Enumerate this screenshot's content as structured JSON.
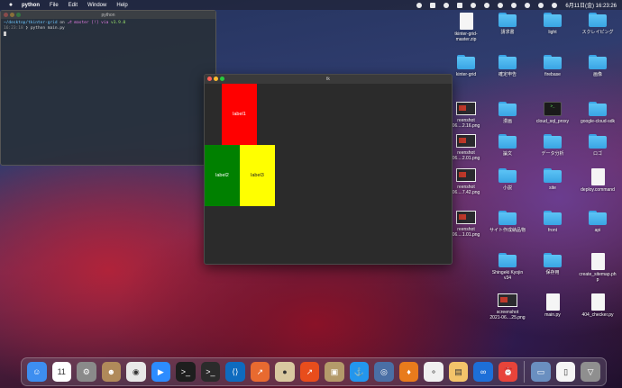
{
  "menubar": {
    "app_name": "python",
    "items": [
      "File",
      "Edit",
      "Window",
      "Help"
    ],
    "clock": "6月11日(金)  16:23:26"
  },
  "terminal": {
    "title": "python",
    "line1_path": "~/desktop/tkinter-grid",
    "line1_on": " on ",
    "line1_branch": "⎇ master [!] via ",
    "line1_ver": "v3.9.0",
    "line2_time": "16:23:18",
    "line2_cmd": " ❯ python main.py"
  },
  "tk_window": {
    "title": "tk",
    "labels": [
      {
        "text": "label1",
        "color": "#ff0000"
      },
      {
        "text": "label2",
        "color": "#008000"
      },
      {
        "text": "label3",
        "color": "#ffff00"
      }
    ]
  },
  "desktop": {
    "items": [
      {
        "label": "tkinter-grid-\nmaster.zip",
        "kind": "zip"
      },
      {
        "label": "請求書",
        "kind": "folder"
      },
      {
        "label": "light",
        "kind": "folder"
      },
      {
        "label": "スクレイピング",
        "kind": "folder"
      },
      {
        "label": "kinter-grid",
        "kind": "folder"
      },
      {
        "label": "確定申告",
        "kind": "folder"
      },
      {
        "label": "firebase",
        "kind": "folder"
      },
      {
        "label": "画像",
        "kind": "folder"
      },
      {
        "label": "reenshot\n06....2.16.png",
        "kind": "thumb"
      },
      {
        "label": "漫画",
        "kind": "folder"
      },
      {
        "label": "cloud_sql_proxy",
        "kind": "exec"
      },
      {
        "label": "google-cloud-sdk",
        "kind": "folder"
      },
      {
        "label": "reenshot\n06....2.01.png",
        "kind": "thumb"
      },
      {
        "label": "論文",
        "kind": "folder"
      },
      {
        "label": "データ分析",
        "kind": "folder"
      },
      {
        "label": "ロゴ",
        "kind": "folder"
      },
      {
        "label": "reenshot\n06....7.42.png",
        "kind": "thumb"
      },
      {
        "label": "小説",
        "kind": "folder"
      },
      {
        "label": "site",
        "kind": "folder"
      },
      {
        "label": "deploy.command",
        "kind": "doc"
      },
      {
        "label": "reenshot\n06....1.01.png",
        "kind": "thumb"
      },
      {
        "label": "サイト作成納品物",
        "kind": "folder"
      },
      {
        "label": "front",
        "kind": "folder"
      },
      {
        "label": "api",
        "kind": "folder"
      },
      {
        "label": "Shingeki Kyojin\nv34",
        "kind": "folder"
      },
      {
        "label": "保存用",
        "kind": "folder"
      },
      {
        "label": "create_sitemap.ph\np",
        "kind": "doc"
      },
      {
        "label": "screenshot\n2021-06....25.png",
        "kind": "thumb"
      },
      {
        "label": "main.py",
        "kind": "doc"
      },
      {
        "label": "404_checker.py",
        "kind": "doc"
      }
    ]
  },
  "dock": {
    "apps": [
      {
        "name": "finder-icon",
        "color": "#3d8ef0",
        "glyph": "☺"
      },
      {
        "name": "calendar-icon",
        "color": "#ffffff",
        "glyph": "11"
      },
      {
        "name": "system-preferences-icon",
        "color": "#8a8a8a",
        "glyph": "⚙"
      },
      {
        "name": "contacts-icon",
        "color": "#b08a5a",
        "glyph": "☻"
      },
      {
        "name": "chrome-icon",
        "color": "#e8e8e8",
        "glyph": "◉"
      },
      {
        "name": "zoom-icon",
        "color": "#2d8cff",
        "glyph": "▶"
      },
      {
        "name": "terminal-icon",
        "color": "#1e1e1e",
        "glyph": ">_"
      },
      {
        "name": "terminal-alt-icon",
        "color": "#2b2b2b",
        "glyph": ">_"
      },
      {
        "name": "vscode-icon",
        "color": "#0e6bbf",
        "glyph": "⟨⟩"
      },
      {
        "name": "compass-icon",
        "color": "#e86a30",
        "glyph": "↗"
      },
      {
        "name": "python-launcher-icon",
        "color": "#d9c8a0",
        "glyph": "●"
      },
      {
        "name": "activity-icon",
        "color": "#e84d1c",
        "glyph": "↗"
      },
      {
        "name": "archive-icon",
        "color": "#b49a6a",
        "glyph": "▣"
      },
      {
        "name": "docker-icon",
        "color": "#2396ed",
        "glyph": "⚓"
      },
      {
        "name": "proxyman-icon",
        "color": "#4a6fa5",
        "glyph": "◎"
      },
      {
        "name": "sourcetree-icon",
        "color": "#e87b1c",
        "glyph": "♦"
      },
      {
        "name": "search-icon",
        "color": "#f0f0f0",
        "glyph": "⚬"
      },
      {
        "name": "notes-icon",
        "color": "#f3c46a",
        "glyph": "▤"
      },
      {
        "name": "infinity-icon",
        "color": "#1d6fd8",
        "glyph": "∞"
      },
      {
        "name": "clock-icon",
        "color": "#e8443a",
        "glyph": "⏰"
      },
      {
        "name": "screenshot-icon",
        "color": "#6a8fc0",
        "glyph": "▭"
      },
      {
        "name": "document-icon",
        "color": "#f5f5f5",
        "glyph": "▯"
      },
      {
        "name": "trash-icon",
        "color": "#8f8f8f",
        "glyph": "▽"
      }
    ]
  }
}
